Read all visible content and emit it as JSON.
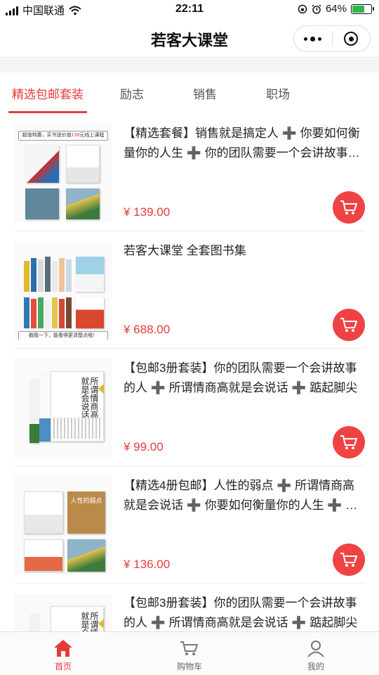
{
  "status_bar": {
    "carrier": "中国联通",
    "time": "22:11",
    "battery": "64%",
    "battery_level": 0.64
  },
  "nav": {
    "title": "若客大课堂"
  },
  "tabs": [
    {
      "label": "精选包邮套装",
      "active": true
    },
    {
      "label": "励志",
      "active": false
    },
    {
      "label": "销售",
      "active": false
    },
    {
      "label": "职场",
      "active": false
    }
  ],
  "products": [
    {
      "title": "【精选套餐】销售就是搞定人 ➕ 你要如何衡量你的人生 ➕ 你的团队需要一个会讲故事的人",
      "price": "¥ 139.00",
      "banner_text": "超值特惠，买书送价值",
      "banner_highlight": "138",
      "banner_suffix": "元线上课程"
    },
    {
      "title": "若客大课堂 全套图书集",
      "price": "¥ 688.00",
      "banner_text": "戳我一下，能看得更清楚点哦！"
    },
    {
      "title": "【包邮3册套装】你的团队需要一个会讲故事的人 ➕ 所谓情商高就是会说话 ➕ 踮起脚尖",
      "price": "¥ 99.00",
      "cover_text": "所谓情商高就是会说话"
    },
    {
      "title": "【精选4册包邮】人性的弱点 ➕ 所谓情商高就是会说话 ➕ 你要如何衡量你的人生 ➕ 销售就是搞定人",
      "price": "¥ 136.00",
      "cover_text": "人性的弱点"
    },
    {
      "title": "【包邮3册套装】你的团队需要一个会讲故事的人 ➕ 所谓情商高就是会说话 ➕ 踮起脚尖",
      "price": "",
      "cover_text": "所谓情商高就是会说话"
    }
  ],
  "tabbar": [
    {
      "label": "首页",
      "icon": "home-icon",
      "active": true
    },
    {
      "label": "购物车",
      "icon": "cart-icon",
      "active": false
    },
    {
      "label": "我的",
      "icon": "user-icon",
      "active": false
    }
  ],
  "colors": {
    "accent": "#e63b3b",
    "cart_button": "#ef4343"
  }
}
